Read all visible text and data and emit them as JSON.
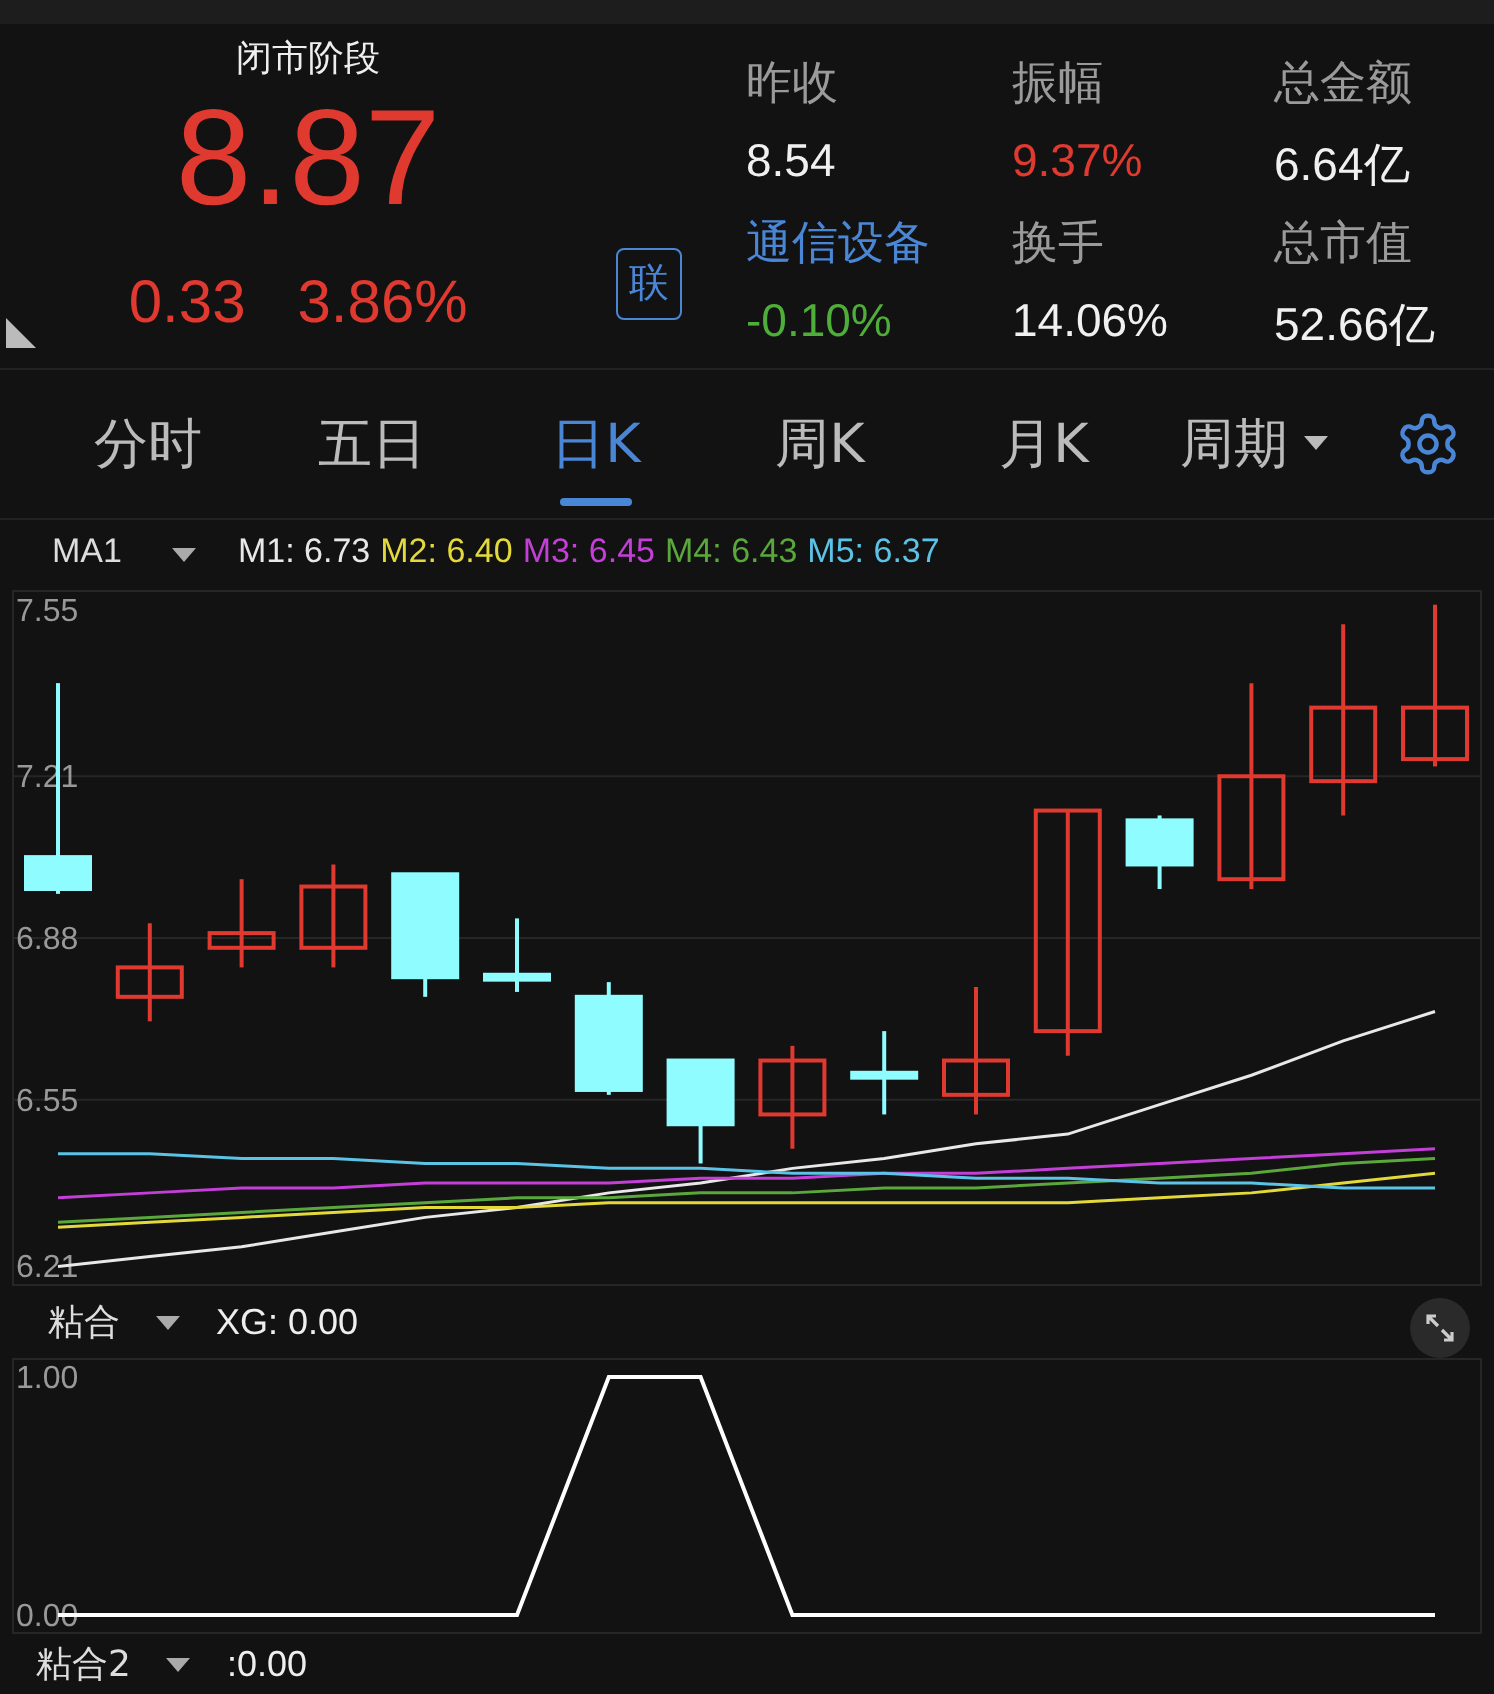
{
  "quote": {
    "status": "闭市阶段",
    "price": "8.87",
    "change": "0.33",
    "change_pct": "3.86%",
    "link_badge": "联"
  },
  "stats": [
    {
      "label": "昨收",
      "value": "8.54",
      "kind": "plain"
    },
    {
      "label": "振幅",
      "value": "9.37%",
      "kind": "up"
    },
    {
      "label": "总金额",
      "value": "6.64亿",
      "kind": "plain"
    },
    {
      "label": "通信设备",
      "value": "-0.10%",
      "kind": "sector"
    },
    {
      "label": "换手",
      "value": "14.06%",
      "kind": "plain"
    },
    {
      "label": "总市值",
      "value": "52.66亿",
      "kind": "plain"
    }
  ],
  "tabs": [
    {
      "label": "分时",
      "selected": false,
      "kind": "tab"
    },
    {
      "label": "五日",
      "selected": false,
      "kind": "tab"
    },
    {
      "label": "日K",
      "selected": true,
      "kind": "tab"
    },
    {
      "label": "周K",
      "selected": false,
      "kind": "tab"
    },
    {
      "label": "月K",
      "selected": false,
      "kind": "tab"
    },
    {
      "label": "周期",
      "selected": false,
      "kind": "dropdown"
    }
  ],
  "price_chart": {
    "indicator": "MA1",
    "legend_values": [
      "6.73",
      "6.40",
      "6.45",
      "6.43",
      "6.37"
    ],
    "chart_data": {
      "type": "line",
      "grid": true,
      "ylim": [
        6.17,
        7.59
      ],
      "yticks": [
        {
          "value": 7.55,
          "label": "7.55"
        },
        {
          "value": 7.21,
          "label": "7.21"
        },
        {
          "value": 6.88,
          "label": "6.88"
        },
        {
          "value": 6.55,
          "label": "6.55"
        },
        {
          "value": 6.21,
          "label": "6.21"
        }
      ],
      "series": [
        {
          "name": "M1:",
          "color": "#e8e8e8",
          "values": [
            6.21,
            6.23,
            6.25,
            6.28,
            6.31,
            6.33,
            6.36,
            6.38,
            6.41,
            6.43,
            6.46,
            6.48,
            6.54,
            6.6,
            6.67,
            6.73
          ]
        },
        {
          "name": "M2:",
          "color": "#e3d93a",
          "values": [
            6.29,
            6.3,
            6.31,
            6.32,
            6.33,
            6.33,
            6.34,
            6.34,
            6.34,
            6.34,
            6.34,
            6.34,
            6.35,
            6.36,
            6.38,
            6.4
          ]
        },
        {
          "name": "M3:",
          "color": "#c43ed8",
          "values": [
            6.35,
            6.36,
            6.37,
            6.37,
            6.38,
            6.38,
            6.38,
            6.39,
            6.39,
            6.4,
            6.4,
            6.41,
            6.42,
            6.43,
            6.44,
            6.45
          ]
        },
        {
          "name": "M4:",
          "color": "#5aa83c",
          "values": [
            6.3,
            6.31,
            6.32,
            6.33,
            6.34,
            6.35,
            6.35,
            6.36,
            6.36,
            6.37,
            6.37,
            6.38,
            6.39,
            6.4,
            6.42,
            6.43
          ]
        },
        {
          "name": "M5:",
          "color": "#5bc3e6",
          "values": [
            6.44,
            6.44,
            6.43,
            6.43,
            6.42,
            6.42,
            6.41,
            6.41,
            6.4,
            6.4,
            6.39,
            6.39,
            6.38,
            6.38,
            6.37,
            6.37
          ]
        },
        {
          "type": "candlestick",
          "color": "#e0392f",
          "ohlc": [
            null,
            [
              6.76,
              6.91,
              6.71,
              6.82
            ],
            [
              6.86,
              7.0,
              6.82,
              6.89
            ],
            [
              6.86,
              7.03,
              6.82,
              6.985
            ],
            null,
            null,
            null,
            null,
            [
              6.52,
              6.66,
              6.45,
              6.63
            ],
            null,
            [
              6.56,
              6.78,
              6.52,
              6.63
            ],
            [
              6.69,
              7.14,
              6.64,
              7.14
            ],
            null,
            [
              7.0,
              7.4,
              6.98,
              7.21
            ],
            [
              7.2,
              7.52,
              7.13,
              7.35
            ],
            [
              7.245,
              7.56,
              7.23,
              7.35
            ]
          ]
        },
        {
          "type": "candlestick",
          "color": "#8ffcff",
          "ohlc": [
            [
              7.045,
              7.4,
              6.97,
              6.98
            ],
            null,
            null,
            null,
            [
              7.01,
              7.01,
              6.76,
              6.8
            ],
            [
              6.805,
              6.92,
              6.77,
              6.795
            ],
            [
              6.76,
              6.79,
              6.56,
              6.57
            ],
            [
              6.63,
              6.63,
              6.42,
              6.5
            ],
            null,
            [
              6.605,
              6.69,
              6.52,
              6.595
            ],
            null,
            null,
            [
              7.12,
              7.13,
              6.98,
              7.03
            ],
            null,
            null,
            null
          ]
        }
      ]
    }
  },
  "indicator": {
    "name": "粘合",
    "reading": "0.00",
    "chart_data": {
      "type": "line",
      "ylim": [
        -0.08,
        1.08
      ],
      "yticks": [
        {
          "value": 1,
          "label": "1.00"
        },
        {
          "value": 0,
          "label": "0.00"
        }
      ],
      "series": [
        {
          "name": "XG:",
          "color": "#ffffff",
          "values": [
            0,
            0,
            0,
            0,
            0,
            0,
            1,
            1,
            0,
            0,
            0,
            0,
            0,
            0,
            0,
            0
          ]
        }
      ]
    }
  },
  "indicator2": {
    "name": "粘合2",
    "reading": ":0.00"
  }
}
